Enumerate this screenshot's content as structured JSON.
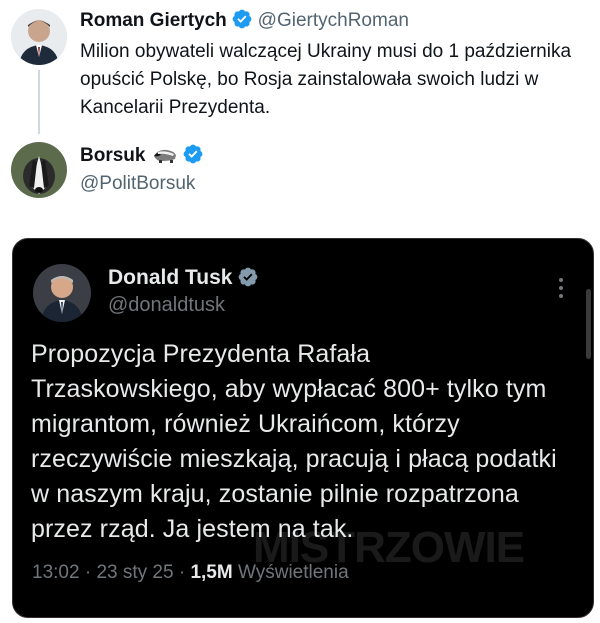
{
  "reply_tweet": {
    "author_name": "Roman Giertych",
    "author_handle": "@GiertychRoman",
    "text": "Milion obywateli walczącej Ukrainy musi do 1 października opuścić Polskę, bo Rosja zainstalowała swoich ludzi w Kancelarii Prezydenta."
  },
  "quoting_tweet": {
    "author_name": "Borsuk",
    "author_handle": "@PolitBorsuk"
  },
  "embedded_tweet": {
    "author_name": "Donald Tusk",
    "author_handle": "@donaldtusk",
    "text": "Propozycja Prezydenta Rafała Trzaskowskiego, aby wypłacać 800+ tylko tym migrantom, również Ukraińcom, którzy rzeczywiście mieszkają, pracują i płacą podatki w naszym kraju, zostanie pilnie rozpatrzona przez rząd. Ja jestem na tak.",
    "time": "13:02",
    "date": "23 sty 25",
    "views_count": "1,5M",
    "views_label": "Wyświetlenia"
  },
  "watermark": "MISTRZOWIE",
  "colors": {
    "verified_blue": "#1d9bf0",
    "dark_bg": "#000000",
    "light_bg": "#ffffff"
  },
  "icons": {
    "verified": "verified-badge-icon",
    "badger": "badger-emoji-icon",
    "more": "more-options-icon"
  }
}
